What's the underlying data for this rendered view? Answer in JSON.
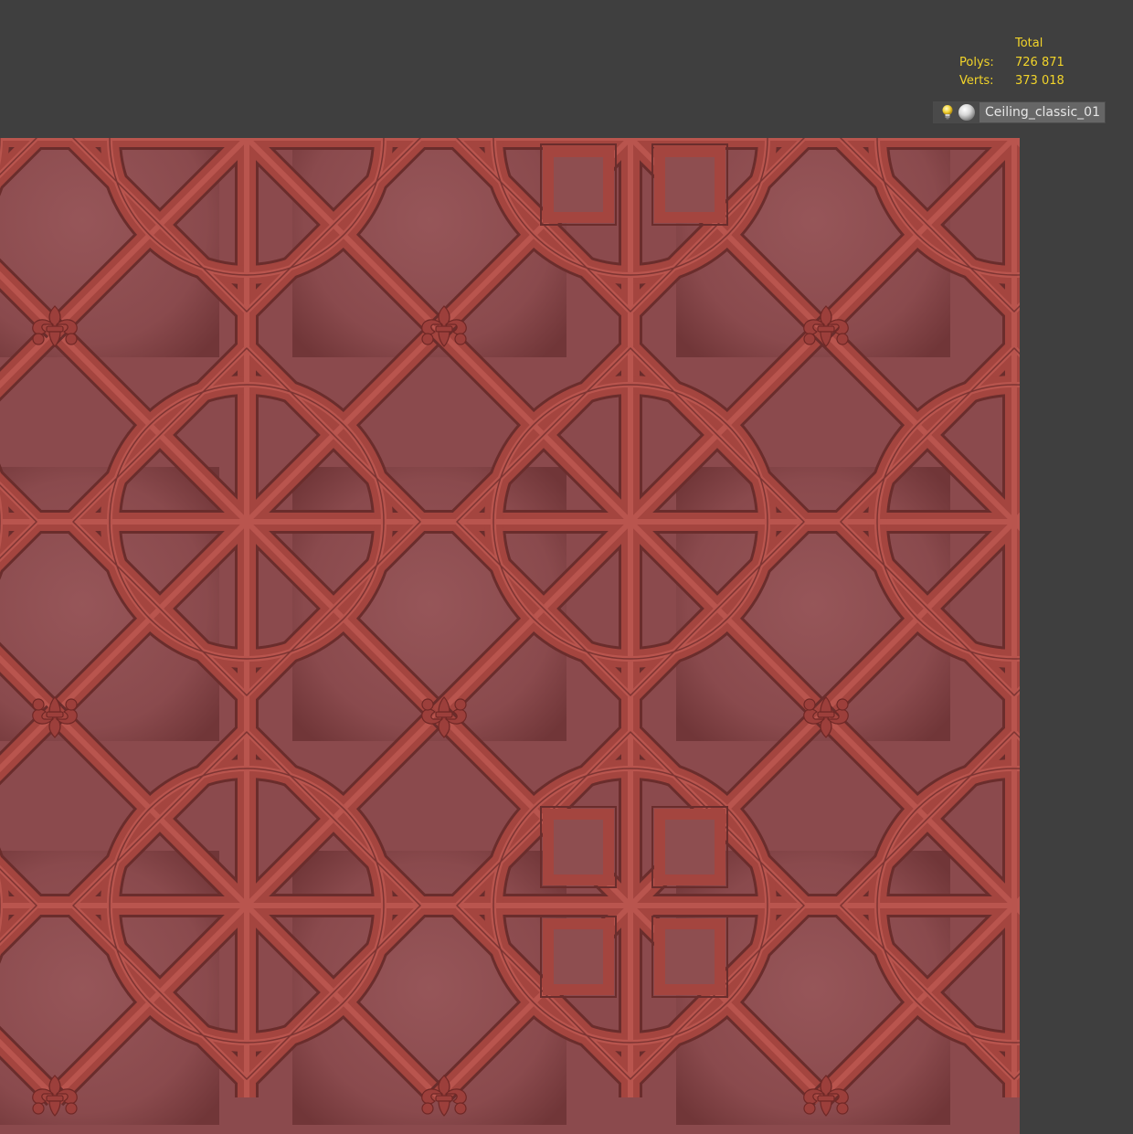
{
  "stats": {
    "header": "Total",
    "polys_label": "Polys:",
    "polys_value": "726 871",
    "verts_label": "Verts:",
    "verts_value": "373 018"
  },
  "object": {
    "name": "Ceiling_classic_01",
    "light_icon": "lightbulb-icon",
    "material_icon": "material-sphere-icon"
  },
  "colors": {
    "background": "#3f3f3f",
    "stats_text": "#f2d42a",
    "model_base": "#8b4a4d",
    "model_molding": "#a6443f"
  }
}
